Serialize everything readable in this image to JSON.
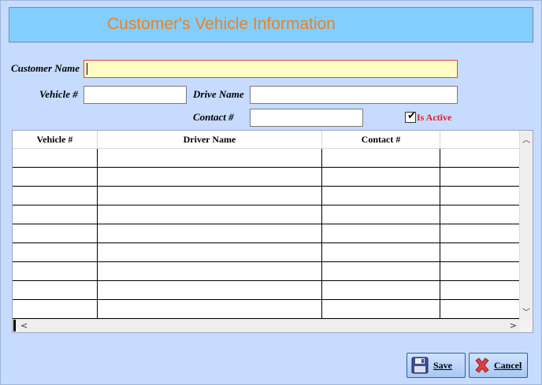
{
  "header": {
    "title": "Customer's Vehicle Information"
  },
  "form": {
    "customer_name_label": "Customer Name",
    "customer_name_value": "",
    "vehicle_label": "Vehicle #",
    "vehicle_value": "",
    "drive_name_label": "Drive Name",
    "drive_name_value": "",
    "contact_label": "Contact #",
    "contact_value": "",
    "is_active_label": "Is Active",
    "is_active_checked": true
  },
  "grid": {
    "columns": [
      "Vehicle #",
      "Driver Name",
      "Contact #",
      ""
    ],
    "rows": [
      [
        "",
        "",
        "",
        ""
      ],
      [
        "",
        "",
        "",
        ""
      ],
      [
        "",
        "",
        "",
        ""
      ],
      [
        "",
        "",
        "",
        ""
      ],
      [
        "",
        "",
        "",
        ""
      ],
      [
        "",
        "",
        "",
        ""
      ],
      [
        "",
        "",
        "",
        ""
      ],
      [
        "",
        "",
        "",
        ""
      ],
      [
        "",
        "",
        "",
        ""
      ]
    ]
  },
  "buttons": {
    "save_label": "Save",
    "cancel_label": "Cancel"
  },
  "icons": {
    "save": "floppy-disk-icon",
    "cancel": "red-x-icon",
    "checkbox": "check-mark-icon"
  },
  "colors": {
    "title": "#f07f1e",
    "is_active": "#e01e1e",
    "header_bg": "#82cfff"
  }
}
